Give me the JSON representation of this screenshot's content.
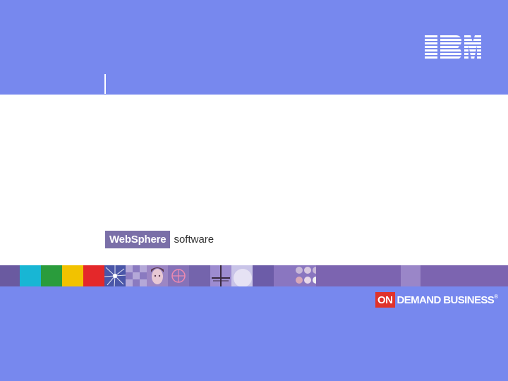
{
  "header": {
    "brand_logo": "IBM"
  },
  "product_logo": {
    "brand": "WebSphere",
    "word": "software"
  },
  "footer_logo": {
    "on": "ON",
    "text": "DEMAND BUSINESS",
    "mark": "®"
  },
  "colors": {
    "background": "#7788ee",
    "content_band": "#ffffff",
    "websphere_box": "#7a6fa8",
    "on_demand_red": "#e0332b",
    "mosaic_cyan": "#18b6d4",
    "mosaic_green": "#2a9c3c",
    "mosaic_yellow": "#f2c200",
    "mosaic_red": "#e4282a"
  }
}
